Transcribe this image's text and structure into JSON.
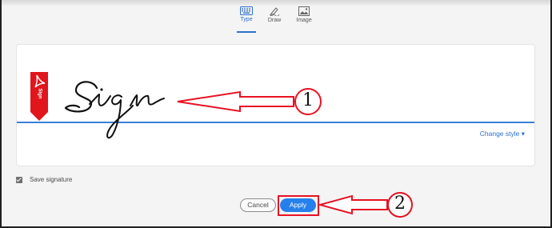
{
  "tabs": [
    {
      "label": "Type",
      "icon": "keyboard-icon",
      "active": true
    },
    {
      "label": "Draw",
      "icon": "pen-icon",
      "active": false
    },
    {
      "label": "Image",
      "icon": "image-icon",
      "active": false
    }
  ],
  "signature": {
    "text": "Sign",
    "bookmark_text": "Sign",
    "change_style_label": "Change style ▾"
  },
  "save_signature": {
    "label": "Save signature",
    "checked": true
  },
  "buttons": {
    "cancel_label": "Cancel",
    "apply_label": "Apply"
  },
  "annotations": {
    "marker1": "1",
    "marker2": "2"
  },
  "colors": {
    "accent": "#2680eb",
    "annotation": "#e81123",
    "bookmark": "#e0161c"
  }
}
